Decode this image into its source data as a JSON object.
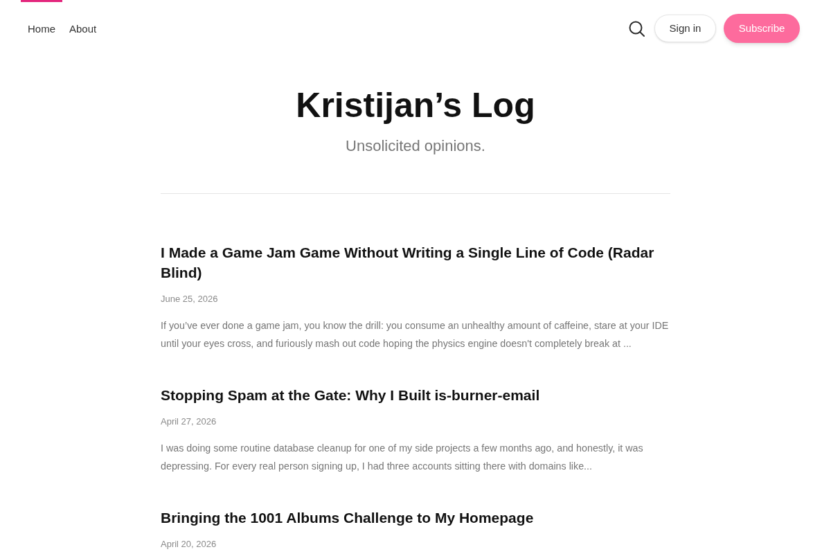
{
  "nav": {
    "items": [
      {
        "label": "Home",
        "selected": true
      },
      {
        "label": "About",
        "selected": false
      }
    ],
    "sign_in": "Sign in",
    "subscribe": "Subscribe"
  },
  "header": {
    "title": "Kristijan’s Log",
    "subtitle": "Unsolicited opinions."
  },
  "posts": [
    {
      "title": "I Made a Game Jam Game Without Writing a Single Line of Code (Radar Blind)",
      "date": "June 25, 2026",
      "excerpt": "If you’ve ever done a game jam, you know the drill: you consume an unhealthy amount of caffeine, stare at your IDE until your eyes cross, and furiously mash out code hoping the physics engine doesn't completely break at ..."
    },
    {
      "title": "Stopping Spam at the Gate: Why I Built is-burner-email",
      "date": "April 27, 2026",
      "excerpt": "I was doing some routine database cleanup for one of my side projects a few months ago, and honestly, it was depressing. For every real person signing up, I had three accounts sitting there with domains like..."
    },
    {
      "title": "Bringing the 1001 Albums Challenge to My Homepage",
      "date": "April 20, 2026"
    }
  ]
}
